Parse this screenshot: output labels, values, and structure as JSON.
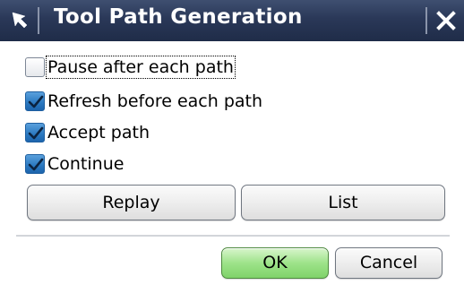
{
  "dialog": {
    "title": "Tool Path Generation",
    "title_icon": "pointer-arrow-icon",
    "close_icon": "close-icon"
  },
  "options": [
    {
      "label": "Pause after each path",
      "checked": false,
      "focused": true
    },
    {
      "label": "Refresh before each path",
      "checked": true,
      "focused": false
    },
    {
      "label": "Accept path",
      "checked": true,
      "focused": false
    },
    {
      "label": "Continue",
      "checked": true,
      "focused": false
    }
  ],
  "actions": {
    "replay_label": "Replay",
    "list_label": "List"
  },
  "footer": {
    "ok_label": "OK",
    "cancel_label": "Cancel"
  },
  "colors": {
    "titlebar": "#2a3858",
    "checkbox_checked": "#2a78c0",
    "ok_button": "#9ee38a"
  }
}
